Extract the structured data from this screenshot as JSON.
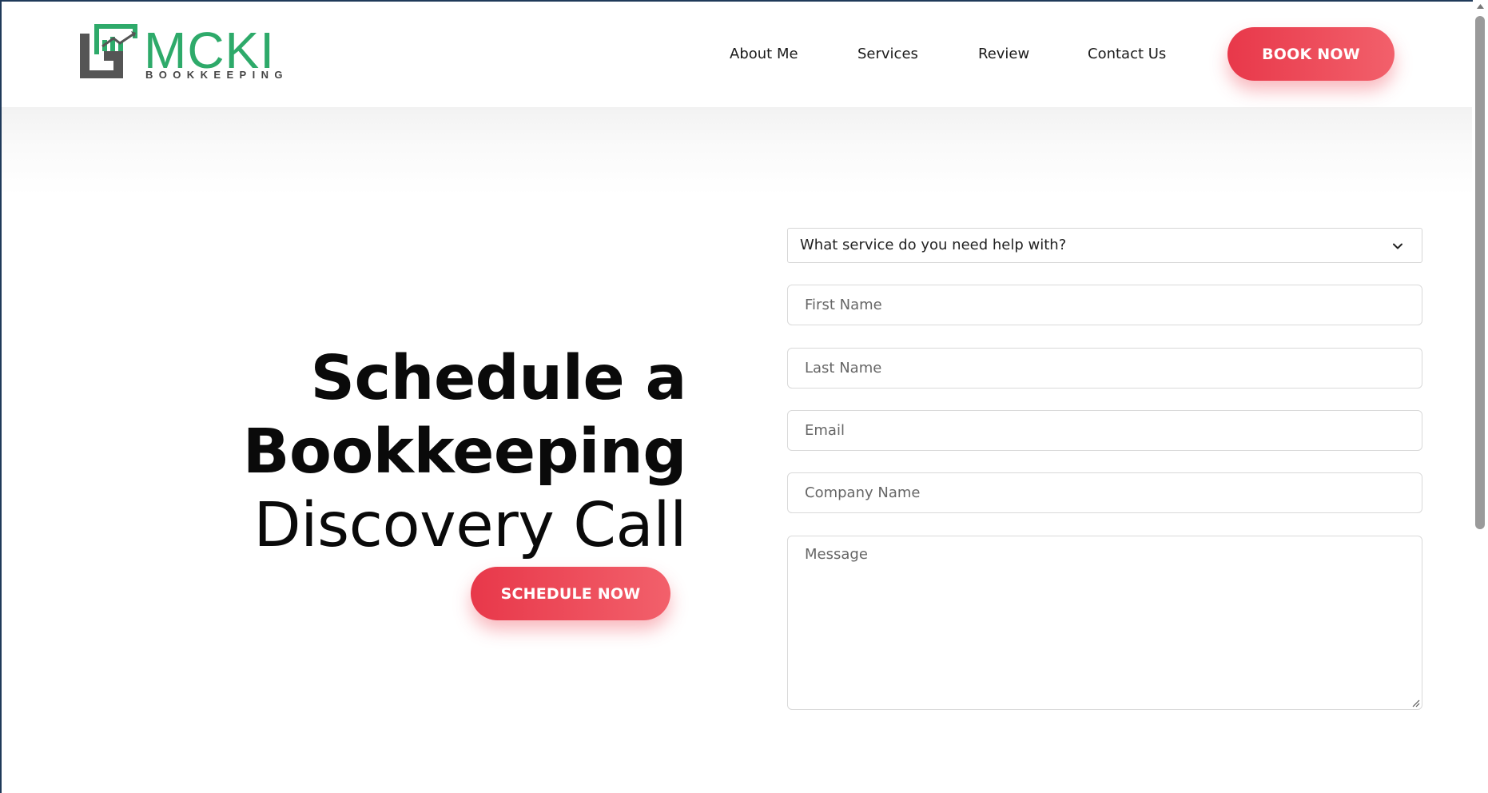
{
  "header": {
    "logo": {
      "text": "MCKI",
      "subtext": "BOOKKEEPING",
      "accent": "#2eaa6a"
    },
    "nav": [
      {
        "label": "About Me"
      },
      {
        "label": "Services"
      },
      {
        "label": "Review"
      },
      {
        "label": "Contact Us"
      }
    ],
    "book_label": "BOOK NOW"
  },
  "hero": {
    "line1": "Schedule a",
    "line2": "Bookkeeping",
    "line3": "Discovery Call",
    "cta_label": "SCHEDULE NOW"
  },
  "form": {
    "service_select": {
      "value": "What service do you need help with?",
      "icon": "chevron-down-icon"
    },
    "first_name_placeholder": "First Name",
    "last_name_placeholder": "Last Name",
    "email_placeholder": "Email",
    "company_placeholder": "Company Name",
    "message_placeholder": "Message"
  },
  "colors": {
    "button_red": "#e8384a",
    "button_red_light": "#f2606b",
    "logo_green": "#2eaa6a",
    "logo_gray": "#555555"
  }
}
